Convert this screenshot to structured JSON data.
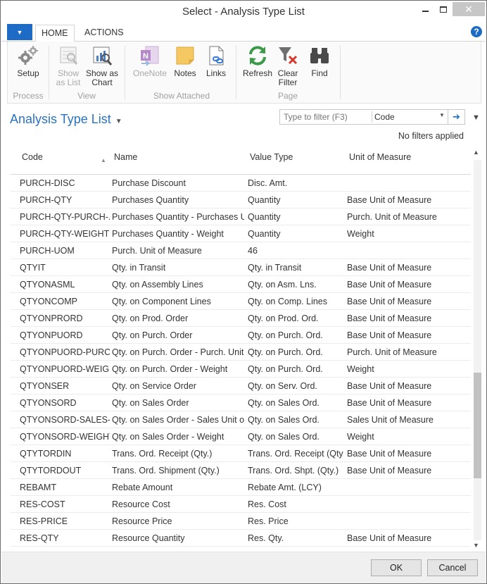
{
  "window": {
    "title": "Select - Analysis Type List"
  },
  "ribbon": {
    "tabs": [
      "HOME",
      "ACTIONS"
    ],
    "groups": {
      "process": {
        "label": "Process",
        "setup_label": "Setup"
      },
      "view": {
        "label": "View",
        "show_as_list_label": "Show as List",
        "show_as_chart_label": "Show as Chart"
      },
      "show_attached": {
        "label": "Show Attached",
        "onenote_label": "OneNote",
        "notes_label": "Notes",
        "links_label": "Links"
      },
      "page": {
        "label": "Page",
        "refresh_label": "Refresh",
        "clear_filter_label": "Clear Filter",
        "find_label": "Find"
      }
    }
  },
  "page": {
    "title": "Analysis Type List",
    "filter": {
      "placeholder": "Type to filter (F3)",
      "field": "Code"
    },
    "no_filters_text": "No filters applied"
  },
  "table": {
    "columns": [
      "Code",
      "Name",
      "Value Type",
      "Unit of Measure"
    ],
    "rows": [
      {
        "code": "PURCH-DISC",
        "name": "Purchase Discount",
        "value_type": "Disc. Amt.",
        "uom": ""
      },
      {
        "code": "PURCH-QTY",
        "name": "Purchases Quantity",
        "value_type": "Quantity",
        "uom": "Base Unit of Measure"
      },
      {
        "code": "PURCH-QTY-PURCH-...",
        "name": "Purchases Quantity - Purchases Un...",
        "value_type": "Quantity",
        "uom": "Purch. Unit of Measure"
      },
      {
        "code": "PURCH-QTY-WEIGHT",
        "name": "Purchases Quantity - Weight",
        "value_type": "Quantity",
        "uom": "Weight"
      },
      {
        "code": "PURCH-UOM",
        "name": "Purch. Unit of Measure",
        "value_type": "46",
        "uom": ""
      },
      {
        "code": "QTYIT",
        "name": "Qty. in Transit",
        "value_type": "Qty. in Transit",
        "uom": "Base Unit of Measure"
      },
      {
        "code": "QTYONASML",
        "name": "Qty. on Assembly Lines",
        "value_type": "Qty. on Asm. Lns.",
        "uom": "Base Unit of Measure"
      },
      {
        "code": "QTYONCOMP",
        "name": "Qty. on Component Lines",
        "value_type": "Qty. on Comp. Lines",
        "uom": "Base Unit of Measure"
      },
      {
        "code": "QTYONPRORD",
        "name": "Qty. on Prod. Order",
        "value_type": "Qty. on Prod. Ord.",
        "uom": "Base Unit of Measure"
      },
      {
        "code": "QTYONPUORD",
        "name": "Qty. on Purch. Order",
        "value_type": "Qty. on Purch. Ord.",
        "uom": "Base Unit of Measure"
      },
      {
        "code": "QTYONPUORD-PURC...",
        "name": "Qty. on Purch. Order - Purch. Unit ...",
        "value_type": "Qty. on Purch. Ord.",
        "uom": "Purch. Unit of Measure"
      },
      {
        "code": "QTYONPUORD-WEIG...",
        "name": "Qty. on Purch. Order - Weight",
        "value_type": "Qty. on Purch. Ord.",
        "uom": "Weight"
      },
      {
        "code": "QTYONSER",
        "name": "Qty. on Service Order",
        "value_type": "Qty. on Serv. Ord.",
        "uom": "Base Unit of Measure"
      },
      {
        "code": "QTYONSORD",
        "name": "Qty. on Sales Order",
        "value_type": "Qty. on Sales Ord.",
        "uom": "Base Unit of Measure"
      },
      {
        "code": "QTYONSORD-SALES-...",
        "name": "Qty. on Sales Order - Sales Unit of...",
        "value_type": "Qty. on Sales Ord.",
        "uom": "Sales Unit of Measure"
      },
      {
        "code": "QTYONSORD-WEIGHT",
        "name": "Qty. on Sales Order - Weight",
        "value_type": "Qty. on Sales Ord.",
        "uom": "Weight"
      },
      {
        "code": "QTYTORDIN",
        "name": "Trans. Ord. Receipt (Qty.)",
        "value_type": "Trans. Ord. Receipt (Qty.)",
        "uom": "Base Unit of Measure"
      },
      {
        "code": "QTYTORDOUT",
        "name": "Trans. Ord. Shipment (Qty.)",
        "value_type": "Trans. Ord. Shpt. (Qty.)",
        "uom": "Base Unit of Measure"
      },
      {
        "code": "REBAMT",
        "name": "Rebate Amount",
        "value_type": "Rebate Amt. (LCY)",
        "uom": ""
      },
      {
        "code": "RES-COST",
        "name": "Resource Cost",
        "value_type": "Res. Cost",
        "uom": ""
      },
      {
        "code": "RES-PRICE",
        "name": "Resource Price",
        "value_type": "Res. Price",
        "uom": ""
      },
      {
        "code": "RES-QTY",
        "name": "Resource Quantity",
        "value_type": "Res. Qty.",
        "uom": "Base Unit of Measure"
      }
    ]
  },
  "footer": {
    "ok_label": "OK",
    "cancel_label": "Cancel"
  },
  "colors": {
    "accent": "#1d6bc4",
    "title_blue": "#2a72c4"
  }
}
